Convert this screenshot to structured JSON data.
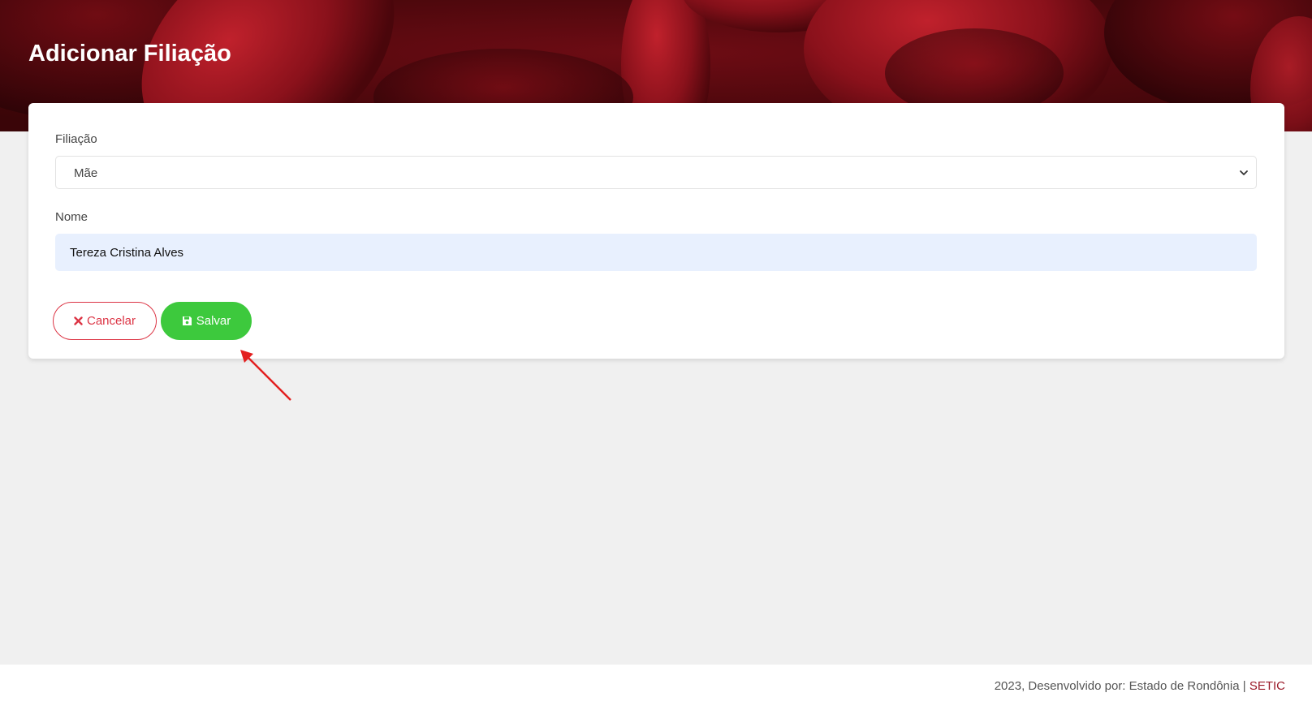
{
  "header": {
    "title": "Adicionar Filiação"
  },
  "form": {
    "filiacao": {
      "label": "Filiação",
      "selected": "Mãe"
    },
    "nome": {
      "label": "Nome",
      "value": "Tereza Cristina Alves"
    }
  },
  "actions": {
    "cancel_label": "Cancelar",
    "save_label": "Salvar"
  },
  "footer": {
    "text": "2023, Desenvolvido por: Estado de Rondônia | ",
    "link": "SETIC"
  },
  "colors": {
    "banner": "#5a0a10",
    "cancel": "#dc3545",
    "save": "#3dc93d",
    "input_fill": "#e8f0fe",
    "footer_link": "#9b1b2a",
    "arrow": "#e32020"
  },
  "icons": {
    "cancel": "times-icon",
    "save": "floppy-disk-icon",
    "select": "chevron-down-icon"
  }
}
